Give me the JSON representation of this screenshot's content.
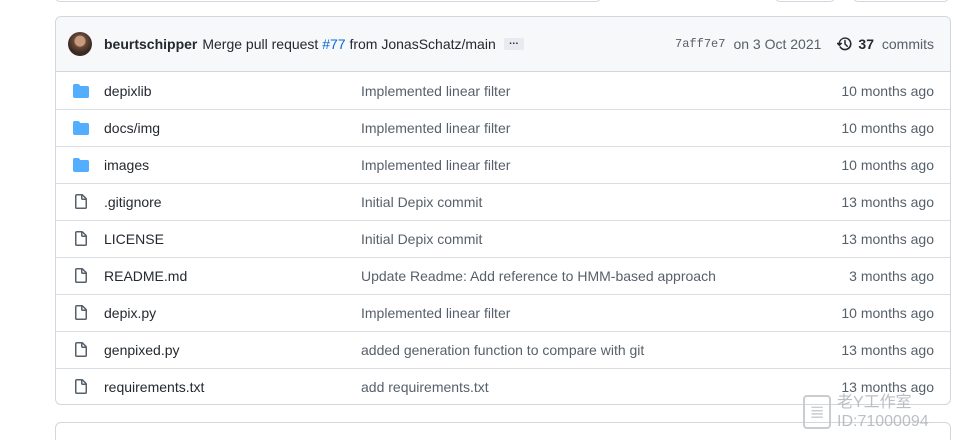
{
  "commit": {
    "author": "beurtschipper",
    "message_prefix": "Merge pull request",
    "pr_ref": "#77",
    "message_suffix": "from JonasSchatz/main",
    "ellipsis": "…",
    "sha": "7aff7e7",
    "date": "on 3 Oct 2021",
    "count": "37",
    "count_label": "commits"
  },
  "files": [
    {
      "name": "depixlib",
      "type": "folder",
      "message": "Implemented linear filter",
      "age": "10 months ago"
    },
    {
      "name": "docs/img",
      "type": "folder",
      "message": "Implemented linear filter",
      "age": "10 months ago"
    },
    {
      "name": "images",
      "type": "folder",
      "message": "Implemented linear filter",
      "age": "10 months ago"
    },
    {
      "name": ".gitignore",
      "type": "file",
      "message": "Initial Depix commit",
      "age": "13 months ago"
    },
    {
      "name": "LICENSE",
      "type": "file",
      "message": "Initial Depix commit",
      "age": "13 months ago"
    },
    {
      "name": "README.md",
      "type": "file",
      "message": "Update Readme: Add reference to HMM-based approach",
      "age": "3 months ago"
    },
    {
      "name": "depix.py",
      "type": "file",
      "message": "Implemented linear filter",
      "age": "10 months ago"
    },
    {
      "name": "genpixed.py",
      "type": "file",
      "message": "added generation function to compare with git",
      "age": "13 months ago"
    },
    {
      "name": "requirements.txt",
      "type": "file",
      "message": "add requirements.txt",
      "age": "13 months ago"
    }
  ],
  "watermark": {
    "line1": "老Y工作室",
    "line2": "ID:71000094"
  },
  "colors": {
    "folder_icon": "#54aeff",
    "file_icon": "#57606a",
    "link": "#0969da",
    "header_bg": "#f6f8fa",
    "border": "#d0d7de"
  }
}
